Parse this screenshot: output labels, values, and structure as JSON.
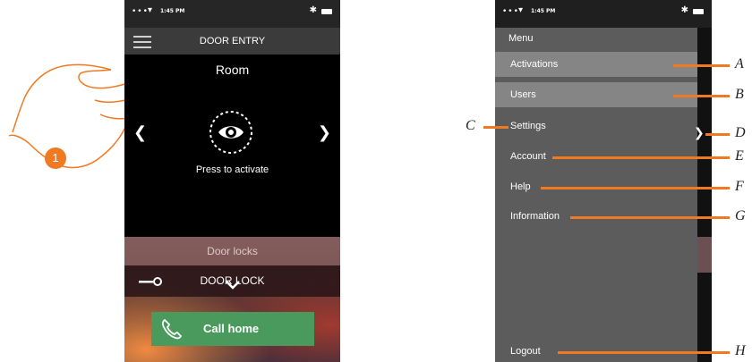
{
  "left_screen": {
    "status": {
      "dots": "•••",
      "time": "1:45 PM"
    },
    "appbar": {
      "title": "DOOR ENTRY"
    },
    "room_title": "Room",
    "activate_label": "Press to activate",
    "door_locks": {
      "section_title": "Door locks",
      "lock_label": "DOOR LOCK"
    },
    "call_button_label": "Call home",
    "step_badge": "1"
  },
  "right_screen": {
    "status": {
      "dots": "•••",
      "time": "1:45 PM"
    },
    "menu": {
      "title": "Menu",
      "items": [
        {
          "label": "Activations",
          "highlighted": true
        },
        {
          "label": "Users",
          "highlighted": true
        },
        {
          "label": "Settings",
          "highlighted": false
        },
        {
          "label": "Account",
          "highlighted": false
        },
        {
          "label": "Help",
          "highlighted": false
        },
        {
          "label": "Information",
          "highlighted": false
        }
      ],
      "logout_label": "Logout"
    }
  },
  "callouts": {
    "A": "A",
    "B": "B",
    "C": "C",
    "D": "D",
    "E": "E",
    "F": "F",
    "G": "G",
    "H": "H"
  },
  "colors": {
    "accent_orange": "#ef7a22",
    "call_green": "#4a9a5e",
    "drawer_gray": "#5c5c5c"
  }
}
